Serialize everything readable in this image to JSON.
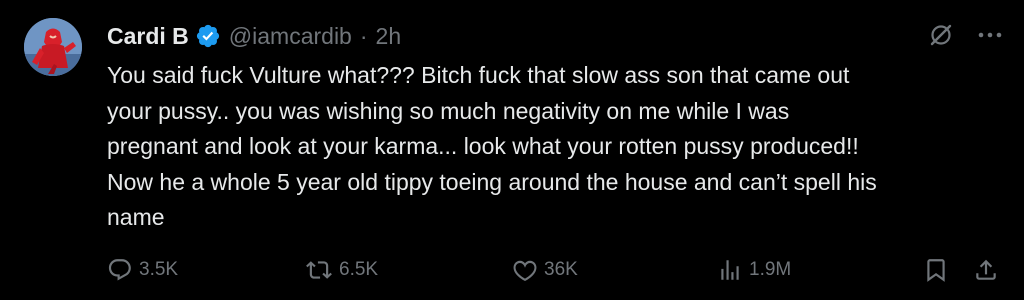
{
  "tweet": {
    "display_name": "Cardi B",
    "handle": "@iamcardib",
    "separator": "·",
    "time": "2h",
    "text": "You said fuck Vulture what??? Bitch fuck that slow ass son that came out\nyour pussy.. you was wishing so much negativity on me while I was\npregnant and look at your karma... look what your rotten pussy produced!!\nNow he a whole 5 year old tippy toeing around the house and can’t spell his\nname"
  },
  "actions": {
    "replies": "3.5K",
    "reposts": "6.5K",
    "likes": "36K",
    "views": "1.9M"
  },
  "icons": {
    "verified": "verified-badge-icon",
    "grok": "grok-icon",
    "more": "more-icon",
    "reply": "reply-icon",
    "repost": "repost-icon",
    "like": "heart-icon",
    "views": "views-icon",
    "bookmark": "bookmark-icon",
    "share": "share-icon"
  },
  "colors": {
    "background": "#000000",
    "primary_text": "#e7e9ea",
    "secondary_text": "#71767b",
    "verified_blue": "#1d9bf0"
  }
}
